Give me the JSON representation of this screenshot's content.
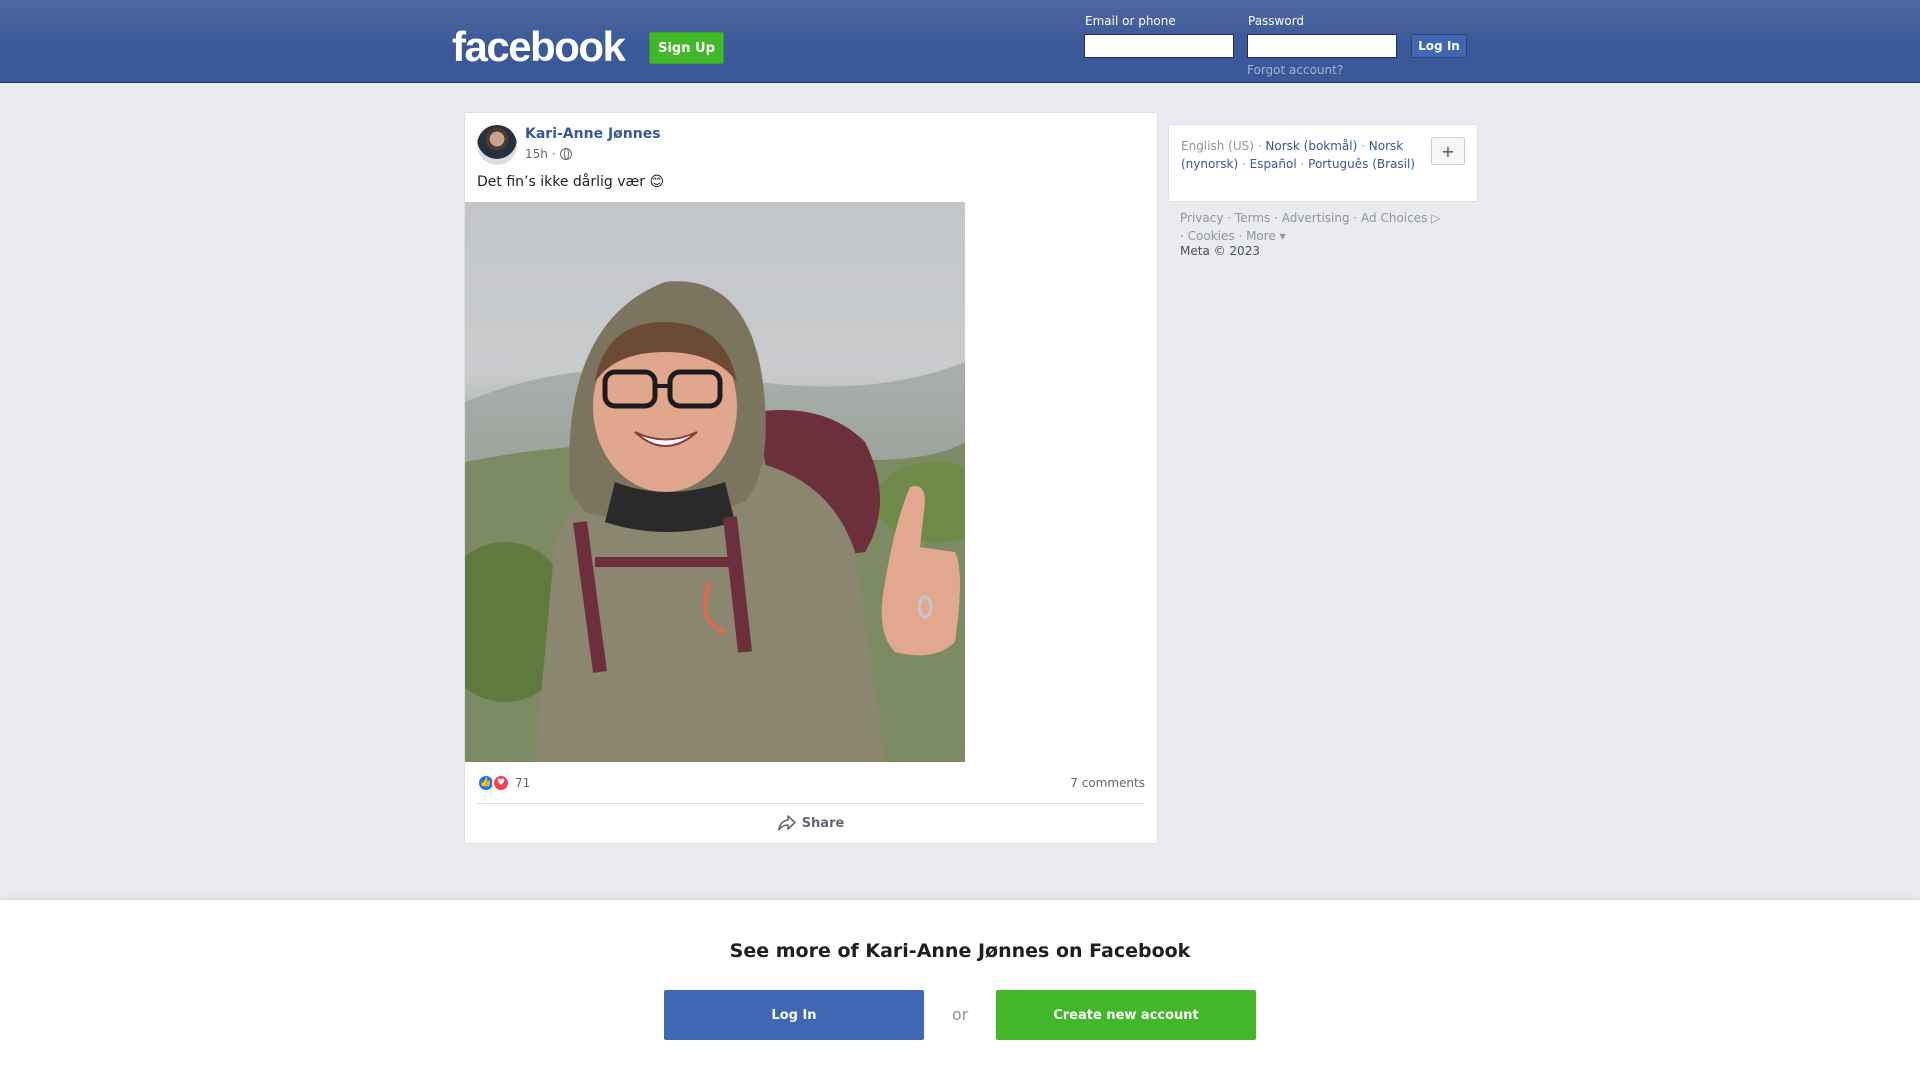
{
  "header": {
    "logo_text": "facebook",
    "signup_label": "Sign Up",
    "email_label": "Email or phone",
    "email_value": "",
    "password_label": "Password",
    "password_value": "",
    "login_label": "Log In",
    "forgot_label": "Forgot account?"
  },
  "post": {
    "author": "Kari-Anne Jønnes",
    "time": "15h",
    "separator": "·",
    "text": "Det fin’s ikke dårlig vær 😊",
    "reaction_count": "71",
    "comments": "7 comments",
    "share_label": "Share"
  },
  "languages": {
    "current": "English (US)",
    "items": [
      "Norsk (bokmål)",
      "Norsk (nynorsk)",
      "Español",
      "Português (Brasil)"
    ],
    "more_symbol": "+"
  },
  "footer": {
    "links": [
      "Privacy",
      "Terms",
      "Advertising",
      "Ad Choices",
      "Cookies",
      "More"
    ],
    "copyright": "Meta © 2023"
  },
  "banner": {
    "title": "See more of Kari-Anne Jønnes on Facebook",
    "login_label": "Log In",
    "or_label": "or",
    "create_label": "Create new account"
  },
  "colors": {
    "brand_blue": "#3b5998",
    "link_blue": "#385898",
    "signup_green": "#42b72a",
    "background": "#e9ebee"
  }
}
